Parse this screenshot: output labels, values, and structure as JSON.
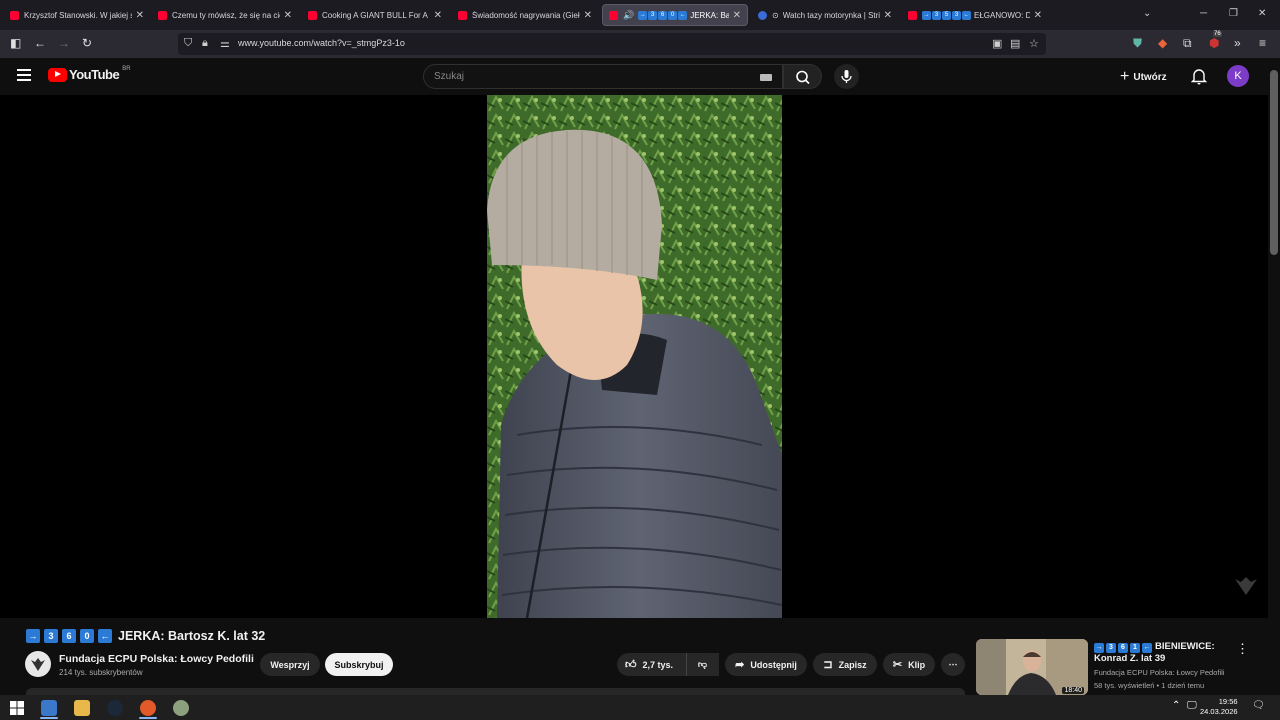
{
  "browser": {
    "tabs": [
      {
        "title": "Krzysztof Stanowski. W jakiej sp",
        "active": false
      },
      {
        "title": "Czemu ty mówisz, że się na cieb",
        "active": false
      },
      {
        "title": "Cooking A GIANT BULL For A G",
        "active": false
      },
      {
        "title": "Świadomość nagrywania (Giełd",
        "active": false
      },
      {
        "title": "JERKA: Bart",
        "active": true
      },
      {
        "title": "Watch tazy motorynka | Stri",
        "active": false
      },
      {
        "title": "EŁGANOWO: D",
        "active": false
      }
    ],
    "tab_badge_nums": [
      "3",
      "6",
      "0"
    ],
    "tab_badge_nums_last": [
      "3",
      "5",
      "3"
    ],
    "url": "www.youtube.com/watch?v=_stmgPz3-1o",
    "extension_badge": "76"
  },
  "youtube": {
    "logo_text": "YouTube",
    "country_code": "BR",
    "search_placeholder": "Szukaj",
    "create_label": "Utwórz",
    "avatar_letter": "K"
  },
  "video": {
    "title_nums": [
      "3",
      "6",
      "0"
    ],
    "title_text": "JERKA: Bartosz K. lat 32",
    "channel_name": "Fundacja ECPU Polska: Łowcy Pedofili",
    "subscribers": "214 tys. subskrybentów",
    "support_label": "Wesprzyj",
    "subscribe_label": "Subskrybuj",
    "likes": "2,7 tys.",
    "share_label": "Udostępnij",
    "save_label": "Zapisz",
    "clip_label": "Klip"
  },
  "recommendation": {
    "title_nums": [
      "3",
      "6",
      "1"
    ],
    "title_line1": "BIENIEWICE:",
    "title_line2": "Konrad Z. lat 39",
    "channel": "Fundacja ECPU Polska: Łowcy Pedofili",
    "meta": "58 tys. wyświetleń • 1 dzień temu",
    "duration": "18:40"
  },
  "taskbar": {
    "time": "19:56",
    "date": "24.03.2026"
  },
  "colors": {
    "youtube_red": "#ff0000",
    "badge_blue": "#2b7bd6",
    "avatar_purple": "#7d3cc8"
  }
}
